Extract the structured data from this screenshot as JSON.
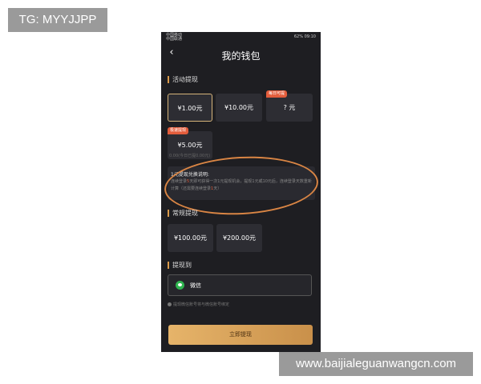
{
  "watermarks": {
    "top_left": "TG: MYYJJPP",
    "bottom_right": "www.baijialeguanwangcn.com"
  },
  "status_bar": {
    "carrier_line1": "中国移动",
    "carrier_line2": "中国联通",
    "signal": "46",
    "battery": "62%",
    "time": "09:10"
  },
  "header": {
    "title": "我的钱包",
    "back_icon": "chevron-left-icon"
  },
  "activity": {
    "section_title": "活动提现",
    "options": [
      {
        "label": "¥1.00元",
        "selected": true
      },
      {
        "label": "¥10.00元"
      },
      {
        "label": "? 元",
        "tag": "每日可提"
      },
      {
        "label": "¥5.00元",
        "tag": "极速提现"
      }
    ],
    "note": "0.00(今日已提0.00元)"
  },
  "info": {
    "title": "1元提现兑换说明:",
    "text_before": "连续登录",
    "highlight_days": "5",
    "text_after": "天即可获得一次1元提现机会，提现1元或10元后，连续登录天数重新计算（还需要连续登录",
    "highlight_remaining": "1",
    "text_end": "天）"
  },
  "regular": {
    "section_title": "常规提现",
    "options": [
      {
        "label": "¥100.00元"
      },
      {
        "label": "¥200.00元"
      }
    ]
  },
  "withdraw_to": {
    "section_title": "提现到",
    "method": "微信",
    "method_icon": "wechat-icon",
    "note": "提现微信账号将与微信账号绑定"
  },
  "submit": {
    "label": "立即提现"
  },
  "colors": {
    "accent": "#d99a4b",
    "tag": "#e35d3c",
    "wechat": "#2fb44f",
    "annotation_circle": "#d98544"
  }
}
